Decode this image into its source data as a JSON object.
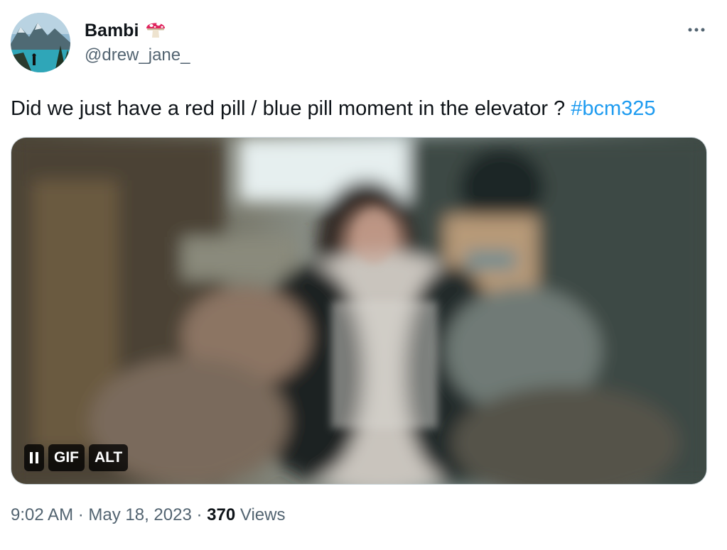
{
  "author": {
    "display_name": "Bambi",
    "name_emoji": "mushroom-icon",
    "handle": "@drew_jane_"
  },
  "tweet": {
    "text": "Did we just have a red pill / blue pill moment in the elevator ? ",
    "hashtag": "#bcm325"
  },
  "media": {
    "type": "GIF",
    "controls": {
      "pause_icon": "pause-icon",
      "gif_label": "GIF",
      "alt_label": "ALT"
    }
  },
  "meta": {
    "time": "9:02 AM",
    "separator1": " · ",
    "date": "May 18, 2023",
    "separator2": " · ",
    "views_count": "370",
    "views_label": " Views"
  },
  "colors": {
    "hashtag": "#1d9bf0",
    "secondary_text": "#536471",
    "primary_text": "#0f1419"
  }
}
